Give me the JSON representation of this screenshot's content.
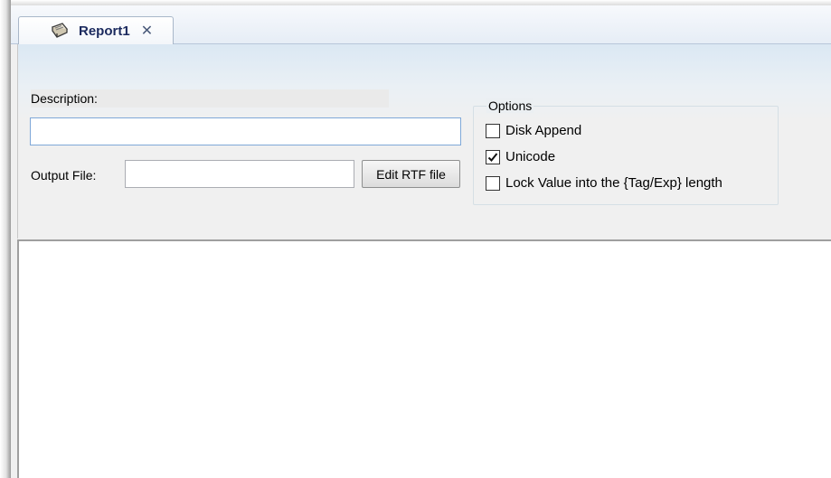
{
  "tab": {
    "label": "Report1",
    "icon": "report-icon",
    "close_glyph": "✕"
  },
  "form": {
    "description_label": "Description:",
    "description_value": "",
    "output_file_label": "Output File:",
    "output_file_value": "",
    "edit_rtf_label": "Edit RTF file"
  },
  "options": {
    "legend": "Options",
    "items": [
      {
        "label": "Disk Append",
        "checked": false
      },
      {
        "label": "Unicode",
        "checked": true
      },
      {
        "label": "Lock Value into the {Tag/Exp} length",
        "checked": false
      }
    ]
  },
  "colors": {
    "tab_text": "#1b2a5e",
    "input_focus_border": "#7fa8d8"
  }
}
